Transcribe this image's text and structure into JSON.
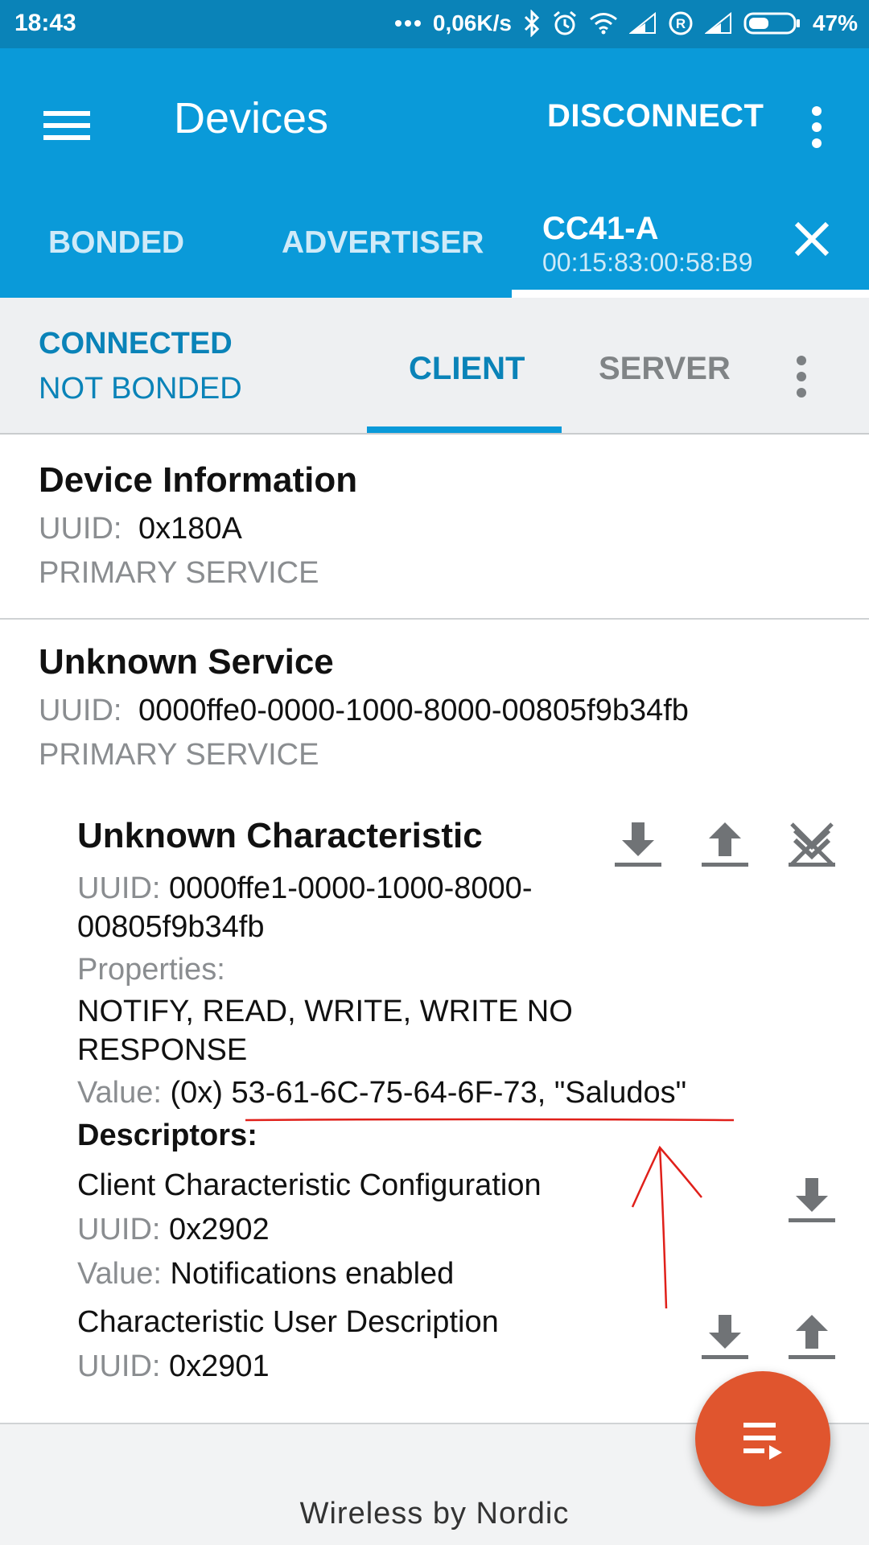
{
  "status_bar": {
    "time": "18:43",
    "network_speed": "0,06K/s",
    "battery_percent": "47%",
    "battery_level": 0.47,
    "icons": [
      "more-dots-icon",
      "bluetooth-icon",
      "alarm-icon",
      "wifi-icon",
      "signal-icon",
      "roaming-icon",
      "signal-icon",
      "battery-icon"
    ]
  },
  "app_bar": {
    "title": "Devices",
    "disconnect_label": "DISCONNECT"
  },
  "tabs": {
    "bonded": "BONDED",
    "advertiser": "ADVERTISER",
    "device_name": "CC41-A",
    "device_address": "00:15:83:00:58:B9"
  },
  "connection": {
    "state": "CONNECTED",
    "bond_state": "NOT BONDED",
    "client_tab": "CLIENT",
    "server_tab": "SERVER"
  },
  "services": [
    {
      "title": "Device Information",
      "uuid_label": "UUID:",
      "uuid": "0x180A",
      "type": "PRIMARY SERVICE"
    },
    {
      "title": "Unknown Service",
      "uuid_label": "UUID:",
      "uuid": "0000ffe0-0000-1000-8000-00805f9b34fb",
      "type": "PRIMARY SERVICE"
    }
  ],
  "characteristic": {
    "title": "Unknown Characteristic",
    "uuid_label": "UUID:",
    "uuid_line1": "0000ffe1-0000-1000-8000-",
    "uuid_line2": "00805f9b34fb",
    "properties_label": "Properties:",
    "properties_line1": "NOTIFY, READ, WRITE, WRITE NO",
    "properties_line2": "RESPONSE",
    "value_label": "Value:",
    "value_prefix": "(0x)",
    "value_hex": "53-61-6C-75-64-6F-73, \"Saludos\"",
    "descriptors_label": "Descriptors:"
  },
  "descriptors": [
    {
      "name": "Client Characteristic Configuration",
      "uuid_label": "UUID:",
      "uuid": "0x2902",
      "value_label": "Value:",
      "value": "Notifications enabled"
    },
    {
      "name": "Characteristic User Description",
      "uuid_label": "UUID:",
      "uuid": "0x2901"
    }
  ],
  "footer": {
    "text": "Wireless by Nordic"
  },
  "colors": {
    "status_bar": "#0a83b8",
    "app_bar": "#0a9ad9",
    "accent_text": "#0a83b8",
    "fab": "#e0552e",
    "annotation": "#e0201a"
  }
}
